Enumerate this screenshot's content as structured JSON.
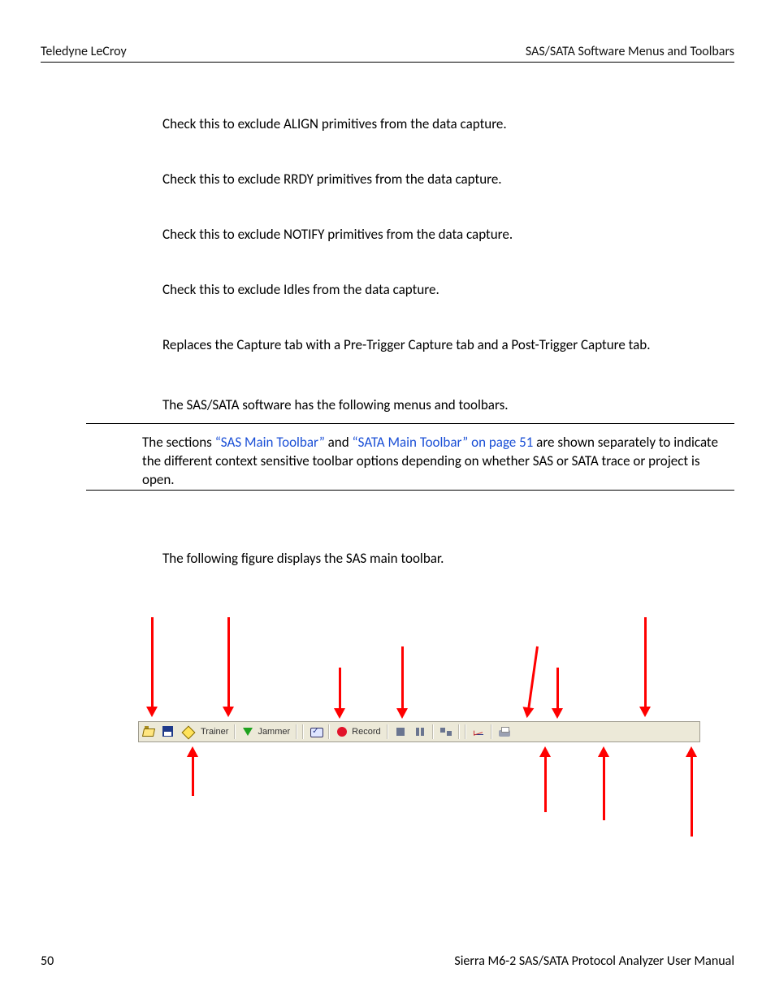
{
  "header": {
    "left": "Teledyne LeCroy",
    "right": "SAS/SATA Software Menus and Toolbars"
  },
  "paragraphs": {
    "p1": "Check this to exclude ALIGN primitives from the data capture.",
    "p2": "Check this to exclude RRDY primitives from the data capture.",
    "p3": "Check this to exclude NOTIFY primitives from the data capture.",
    "p4": "Check this to exclude Idles from the data capture.",
    "p5": "Replaces the Capture tab with a Pre-Trigger Capture tab and a Post-Trigger Capture tab.",
    "p6": "The SAS/SATA software has the following menus and toolbars.",
    "p7": "The following figure displays the SAS main toolbar."
  },
  "note": {
    "pre": "The sections ",
    "link1": "“SAS Main Toolbar”",
    "mid": " and ",
    "link2": "“SATA Main Toolbar” on page 51",
    "post": " are shown separately to indicate the different context sensitive toolbar options depending on whether SAS or SATA trace or project is open."
  },
  "toolbar": {
    "trainer": "Trainer",
    "jammer": "Jammer",
    "record": "Record"
  },
  "footer": {
    "page": "50",
    "manual": "Sierra M6-2 SAS/SATA Protocol Analyzer User Manual"
  }
}
